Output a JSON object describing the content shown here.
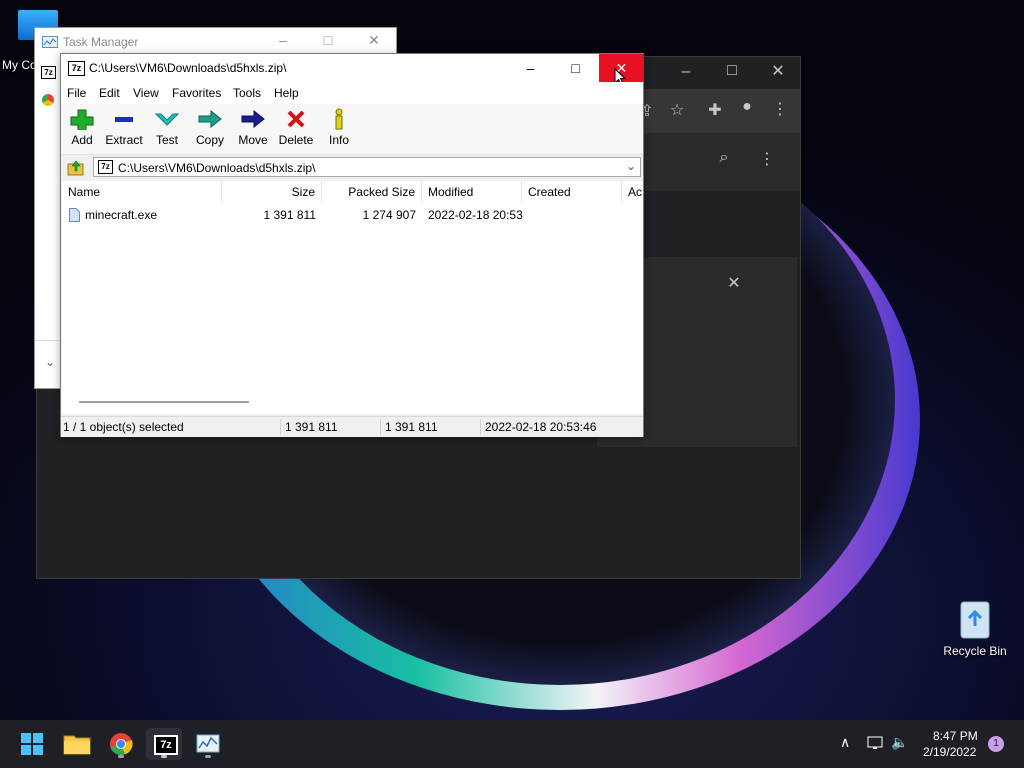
{
  "desktop": {
    "icons": [
      {
        "label": "My Co",
        "icon": "computer-icon"
      },
      {
        "label": "Recycle Bin",
        "icon": "recycle-bin-icon"
      }
    ]
  },
  "task_manager": {
    "title": "Task Manager"
  },
  "zip_window": {
    "title": "C:\\Users\\VM6\\Downloads\\d5hxls.zip\\",
    "app_icon_text": "7z",
    "menu": [
      "File",
      "Edit",
      "View",
      "Favorites",
      "Tools",
      "Help"
    ],
    "toolbar": [
      {
        "label": "Add",
        "icon": "add-icon"
      },
      {
        "label": "Extract",
        "icon": "extract-icon"
      },
      {
        "label": "Test",
        "icon": "test-icon"
      },
      {
        "label": "Copy",
        "icon": "copy-icon"
      },
      {
        "label": "Move",
        "icon": "move-icon"
      },
      {
        "label": "Delete",
        "icon": "delete-icon"
      },
      {
        "label": "Info",
        "icon": "info-icon"
      }
    ],
    "address": "C:\\Users\\VM6\\Downloads\\d5hxls.zip\\",
    "columns": [
      "Name",
      "Size",
      "Packed Size",
      "Modified",
      "Created",
      "Ac"
    ],
    "rows": [
      {
        "name": "minecraft.exe",
        "size": "1 391 811",
        "packed_size": "1 274 907",
        "modified": "2022-02-18 20:53",
        "created": ""
      }
    ],
    "status": {
      "selected": "1 / 1 object(s) selected",
      "size": "1 391 811",
      "packed": "1 391 811",
      "modified": "2022-02-18 20:53:46"
    }
  },
  "taskbar": {
    "apps": [
      "start-icon",
      "file-explorer-icon",
      "chrome-icon",
      "7zip-icon",
      "task-manager-icon"
    ],
    "time": "8:47 PM",
    "date": "2/19/2022",
    "notification_count": "1"
  },
  "colors": {
    "close_red": "#e81123",
    "chrome_dark": "#202124",
    "taskbar": "#1e2026"
  }
}
